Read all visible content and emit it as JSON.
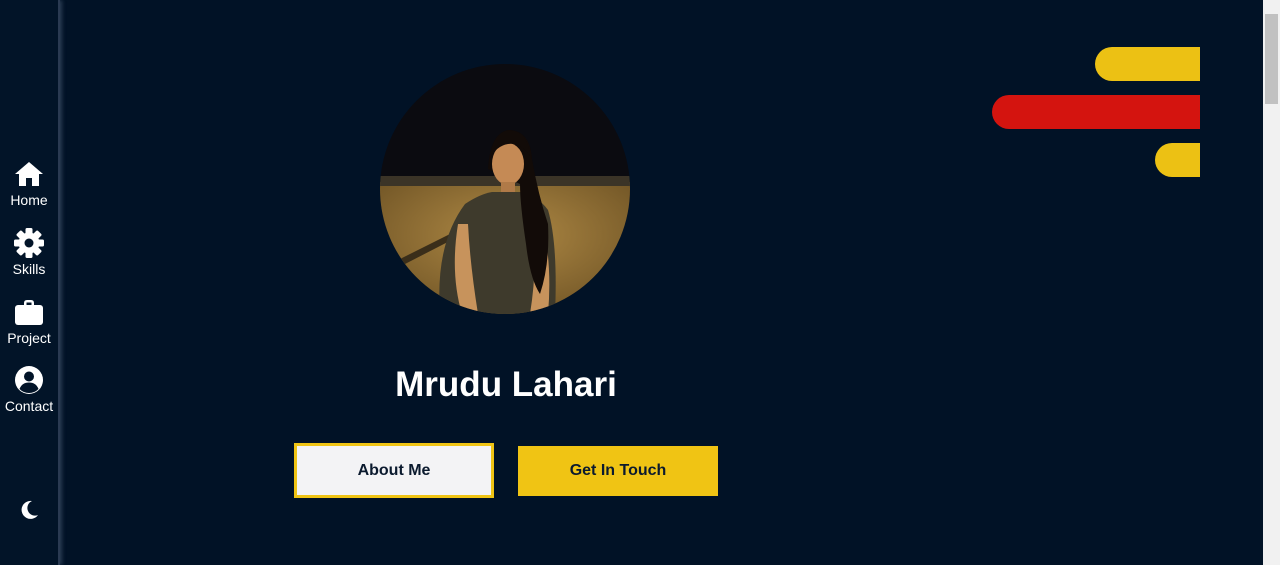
{
  "sidebar": {
    "items": [
      {
        "label": "Home",
        "icon": "home-icon"
      },
      {
        "label": "Skills",
        "icon": "gear-icon"
      },
      {
        "label": "Project",
        "icon": "briefcase-icon"
      },
      {
        "label": "Contact",
        "icon": "user-circle-icon"
      }
    ],
    "theme_toggle_icon": "moon-icon"
  },
  "hero": {
    "name": "Mrudu Lahari",
    "photo": "profile-photo",
    "about_button": "About Me",
    "contact_button": "Get In Touch"
  },
  "colors": {
    "background": "#011226",
    "accent_yellow": "#F0C414",
    "accent_red": "#D4140F"
  }
}
